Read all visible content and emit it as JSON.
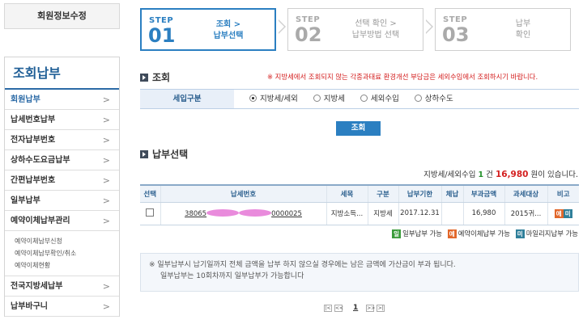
{
  "left": {
    "member_button": "회원정보수정",
    "menu_title": "조회납부",
    "items": [
      {
        "label": "회원납부"
      },
      {
        "label": "납세번호납부"
      },
      {
        "label": "전자납부번호"
      },
      {
        "label": "상하수도요금납부"
      },
      {
        "label": "간편납부번호"
      },
      {
        "label": "일부납부"
      },
      {
        "label": "예약이체납부관리"
      }
    ],
    "submenu": [
      "예약이체납부신청",
      "예약이체납부확인/취소",
      "예약이체현황"
    ],
    "items_after": [
      {
        "label": "전국지방세납부"
      },
      {
        "label": "납부바구니"
      }
    ],
    "arrow": ">"
  },
  "steps": [
    {
      "label": "STEP",
      "num": "01",
      "line1": "조회 >",
      "line2": "납부선택"
    },
    {
      "label": "STEP",
      "num": "02",
      "line1": "선택 확인 >",
      "line2": "납부방법 선택"
    },
    {
      "label": "STEP",
      "num": "03",
      "line1": "납부",
      "line2": "확인"
    }
  ],
  "search": {
    "title": "조회",
    "notice": "※ 지방세에서 조회되지 않는 각종과태료 환경개선 부담금은 세외수입에서 조회하시기 바랍니다.",
    "label": "세입구분",
    "options": [
      "지방세/세외",
      "지방세",
      "세외수입",
      "상하수도"
    ],
    "selected": "지방세/세외",
    "button": "조회"
  },
  "result": {
    "title": "납부선택",
    "summary_prefix": "지방세/세외수입",
    "count": "1",
    "count_unit": "건",
    "amount": "16,980",
    "summary_suffix": "원이 있습니다."
  },
  "table": {
    "headers": [
      "선택",
      "납세번호",
      "세목",
      "구분",
      "납부기한",
      "체납",
      "부과금액",
      "과세대상",
      "비고"
    ],
    "rows": [
      {
        "taxno_start": "38065",
        "taxno_end": "0000025",
        "tax_item": "지방소득...",
        "category": "지방세",
        "due_date": "2017.12.31",
        "arrears": "",
        "amount": "16,980",
        "target": "2015귀...",
        "badge1": "예",
        "badge2": "미"
      }
    ]
  },
  "legend": {
    "partial_badge": "일",
    "partial": "일부납부 가능",
    "reserve_badge": "예",
    "reserve": "예약이체납부 가능",
    "mileage_badge": "미",
    "mileage": "마일리지납부 가능"
  },
  "info": {
    "line1": "※ 일부납부시 납기일까지 전체 금액을 납부 하지 않으실 경우에는 남은 금액에 가산금이 부과 됩니다.",
    "line2": "일부납부는 10회차까지 일부납부가 가능합니다"
  },
  "pager": {
    "first": "|<",
    "prev": "<<",
    "page": "1",
    "next": ">>",
    "last": ">|"
  },
  "colors": {
    "accent": "#2b7fc1",
    "menu_title": "#1f5e96",
    "notice_red": "#d42020",
    "orange_badge": "#e2672a",
    "teal_badge": "#2f7f9a",
    "green_badge": "#3a9b3a"
  }
}
